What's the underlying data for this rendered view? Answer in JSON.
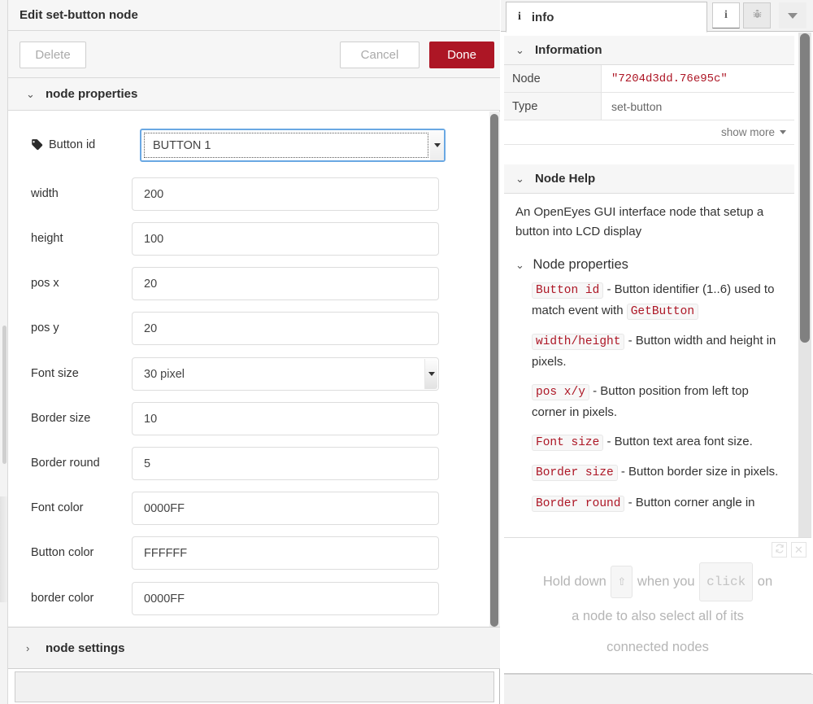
{
  "edit_panel": {
    "title": "Edit set-button node",
    "buttons": {
      "delete": "Delete",
      "cancel": "Cancel",
      "done": "Done"
    },
    "sections": {
      "properties": "node properties",
      "settings": "node settings"
    },
    "fields": [
      {
        "label": "Button id",
        "value": "BUTTON 1",
        "type": "select",
        "icon": "tag-icon",
        "focused": true
      },
      {
        "label": "width",
        "value": "200",
        "type": "text"
      },
      {
        "label": "height",
        "value": "100",
        "type": "text"
      },
      {
        "label": "pos x",
        "value": "20",
        "type": "text"
      },
      {
        "label": "pos y",
        "value": "20",
        "type": "text"
      },
      {
        "label": "Font size",
        "value": "30 pixel",
        "type": "select"
      },
      {
        "label": "Border size",
        "value": "10",
        "type": "text"
      },
      {
        "label": "Border round",
        "value": "5",
        "type": "text"
      },
      {
        "label": "Font color",
        "value": "0000FF",
        "type": "text"
      },
      {
        "label": "Button color",
        "value": "FFFFFF",
        "type": "text"
      },
      {
        "label": "border color",
        "value": "0000FF",
        "type": "text"
      }
    ]
  },
  "sidebar": {
    "tab": {
      "label": "info",
      "icon": "info-icon"
    },
    "tools": [
      {
        "name": "info-icon",
        "glyph": "i"
      },
      {
        "name": "bug-icon",
        "glyph": "bug"
      },
      {
        "name": "chevron-down-icon",
        "glyph": "caret"
      }
    ],
    "information": {
      "header": "Information",
      "rows": [
        {
          "key": "Node",
          "value": "\"7204d3dd.76e95c\"",
          "code": true
        },
        {
          "key": "Type",
          "value": "set-button",
          "code": false
        }
      ],
      "show_more": "show more"
    },
    "node_help": {
      "header": "Node Help",
      "intro": "An OpenEyes GUI interface node that setup a button into LCD display",
      "subheader": "Node properties",
      "items": [
        {
          "kw": "Button id",
          "text_before": "",
          "text": " - Button identifier (1..6) used to match event with ",
          "kw2": "GetButton",
          "text_after": ""
        },
        {
          "kw": "width/height",
          "text": " - Button width and height in pixels."
        },
        {
          "kw": "pos x/y",
          "text": " - Button position from left top corner in pixels."
        },
        {
          "kw": "Font size",
          "text": " - Button text area font size."
        },
        {
          "kw": "Border size",
          "text": " - Button border size in pixels."
        },
        {
          "kw": "Border round",
          "text": " - Button corner angle in"
        }
      ]
    },
    "tip": {
      "part1": "Hold down",
      "key1": "⇧",
      "part2": "when you",
      "key2": "click",
      "part3": "on",
      "line2": "a node to also select all of its",
      "line3": "connected nodes",
      "refresh": "refresh-icon",
      "close": "close-icon"
    }
  },
  "colors": {
    "accent_red": "#AD1625",
    "focus_blue": "#6AA8E3",
    "panel_grey": "#F6F6F6"
  }
}
